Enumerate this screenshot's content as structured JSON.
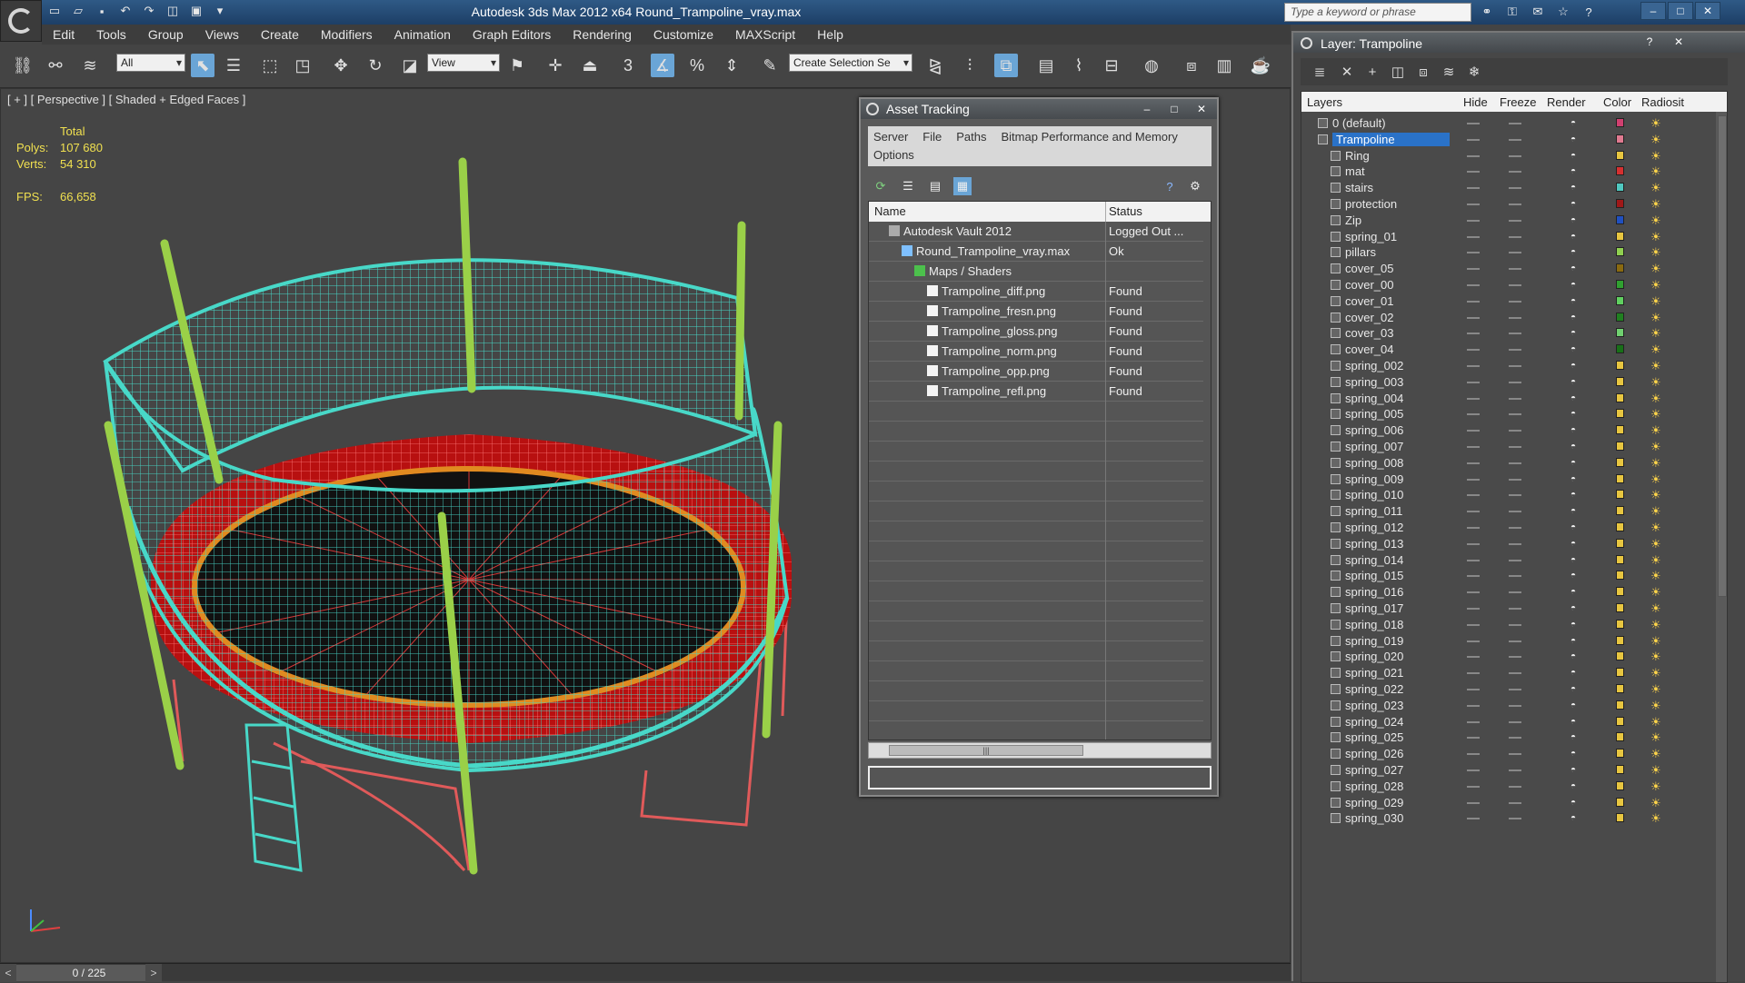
{
  "window": {
    "title": "Autodesk 3ds Max  2012 x64     Round_Trampoline_vray.max",
    "search_placeholder": "Type a keyword or phrase"
  },
  "menu": [
    "Edit",
    "Tools",
    "Group",
    "Views",
    "Create",
    "Modifiers",
    "Animation",
    "Graph Editors",
    "Rendering",
    "Customize",
    "MAXScript",
    "Help"
  ],
  "toolbar": {
    "selection_filter": "All",
    "reference_coord": "View",
    "snap_value": "3",
    "named_selection_placeholder": "Create Selection Se"
  },
  "viewport": {
    "label": "[ + ] [ Perspective ] [ Shaded + Edged Faces ]",
    "stats": {
      "header": "Total",
      "polys_label": "Polys:",
      "polys_value": "107 680",
      "verts_label": "Verts:",
      "verts_value": "54 310",
      "fps_label": "FPS:",
      "fps_value": "66,658"
    }
  },
  "timeslider": {
    "frame": "0 / 225",
    "prev": "<",
    "next": ">"
  },
  "asset_tracking": {
    "title": "Asset Tracking",
    "menus_row1": [
      "Server",
      "File",
      "Paths",
      "Bitmap Performance and Memory"
    ],
    "menus_row2": [
      "Options"
    ],
    "col_name": "Name",
    "col_status": "Status",
    "rows": [
      {
        "name": "Autodesk Vault 2012",
        "status": "Logged Out ...",
        "indent": 1,
        "icon": "vault-icon"
      },
      {
        "name": "Round_Trampoline_vray.max",
        "status": "Ok",
        "indent": 2,
        "icon": "max-file-icon"
      },
      {
        "name": "Maps / Shaders",
        "status": "",
        "indent": 3,
        "icon": "maps-folder-icon"
      },
      {
        "name": "Trampoline_diff.png",
        "status": "Found",
        "indent": 4,
        "icon": "bitmap-icon"
      },
      {
        "name": "Trampoline_fresn.png",
        "status": "Found",
        "indent": 4,
        "icon": "bitmap-icon"
      },
      {
        "name": "Trampoline_gloss.png",
        "status": "Found",
        "indent": 4,
        "icon": "bitmap-icon"
      },
      {
        "name": "Trampoline_norm.png",
        "status": "Found",
        "indent": 4,
        "icon": "bitmap-icon"
      },
      {
        "name": "Trampoline_opp.png",
        "status": "Found",
        "indent": 4,
        "icon": "bitmap-icon"
      },
      {
        "name": "Trampoline_refl.png",
        "status": "Found",
        "indent": 4,
        "icon": "bitmap-icon"
      }
    ],
    "empty_rows": 17
  },
  "layer_panel": {
    "title": "Layer: Trampoline",
    "columns": [
      "Layers",
      "Hide",
      "Freeze",
      "Render",
      "Color",
      "Radiosit"
    ],
    "layers": [
      {
        "name": "0 (default)",
        "color": "#d04070",
        "level": 0
      },
      {
        "name": "Trampoline",
        "color": "#e07a90",
        "level": 0,
        "selected": true
      },
      {
        "name": "Ring",
        "color": "#e8c640",
        "level": 1
      },
      {
        "name": "mat",
        "color": "#d63030",
        "level": 1
      },
      {
        "name": "stairs",
        "color": "#50c8c0",
        "level": 1
      },
      {
        "name": "protection",
        "color": "#a01818",
        "level": 1
      },
      {
        "name": "Zip",
        "color": "#2050c0",
        "level": 1
      },
      {
        "name": "spring_01",
        "color": "#e8c640",
        "level": 1
      },
      {
        "name": "pillars",
        "color": "#90d050",
        "level": 1
      },
      {
        "name": "cover_05",
        "color": "#8a6a10",
        "level": 1
      },
      {
        "name": "cover_00",
        "color": "#30a030",
        "level": 1
      },
      {
        "name": "cover_01",
        "color": "#60d060",
        "level": 1
      },
      {
        "name": "cover_02",
        "color": "#208020",
        "level": 1
      },
      {
        "name": "cover_03",
        "color": "#70d070",
        "level": 1
      },
      {
        "name": "cover_04",
        "color": "#187018",
        "level": 1
      },
      {
        "name": "spring_002",
        "color": "#e8c640",
        "level": 1
      },
      {
        "name": "spring_003",
        "color": "#e8c640",
        "level": 1
      },
      {
        "name": "spring_004",
        "color": "#e8c640",
        "level": 1
      },
      {
        "name": "spring_005",
        "color": "#e8c640",
        "level": 1
      },
      {
        "name": "spring_006",
        "color": "#e8c640",
        "level": 1
      },
      {
        "name": "spring_007",
        "color": "#e8c640",
        "level": 1
      },
      {
        "name": "spring_008",
        "color": "#e8c640",
        "level": 1
      },
      {
        "name": "spring_009",
        "color": "#e8c640",
        "level": 1
      },
      {
        "name": "spring_010",
        "color": "#e8c640",
        "level": 1
      },
      {
        "name": "spring_011",
        "color": "#e8c640",
        "level": 1
      },
      {
        "name": "spring_012",
        "color": "#e8c640",
        "level": 1
      },
      {
        "name": "spring_013",
        "color": "#e8c640",
        "level": 1
      },
      {
        "name": "spring_014",
        "color": "#e8c640",
        "level": 1
      },
      {
        "name": "spring_015",
        "color": "#e8c640",
        "level": 1
      },
      {
        "name": "spring_016",
        "color": "#e8c640",
        "level": 1
      },
      {
        "name": "spring_017",
        "color": "#e8c640",
        "level": 1
      },
      {
        "name": "spring_018",
        "color": "#e8c640",
        "level": 1
      },
      {
        "name": "spring_019",
        "color": "#e8c640",
        "level": 1
      },
      {
        "name": "spring_020",
        "color": "#e8c640",
        "level": 1
      },
      {
        "name": "spring_021",
        "color": "#e8c640",
        "level": 1
      },
      {
        "name": "spring_022",
        "color": "#e8c640",
        "level": 1
      },
      {
        "name": "spring_023",
        "color": "#e8c640",
        "level": 1
      },
      {
        "name": "spring_024",
        "color": "#e8c640",
        "level": 1
      },
      {
        "name": "spring_025",
        "color": "#e8c640",
        "level": 1
      },
      {
        "name": "spring_026",
        "color": "#e8c640",
        "level": 1
      },
      {
        "name": "spring_027",
        "color": "#e8c640",
        "level": 1
      },
      {
        "name": "spring_028",
        "color": "#e8c640",
        "level": 1
      },
      {
        "name": "spring_029",
        "color": "#e8c640",
        "level": 1
      },
      {
        "name": "spring_030",
        "color": "#e8c640",
        "level": 1
      }
    ]
  },
  "colors": {
    "net": "#48d8c8",
    "mat_frame": "#c81818",
    "ring": "#e08a20",
    "pole": "#9ad048",
    "legs": "#e05050",
    "selection_blue": "#2a72c8"
  }
}
